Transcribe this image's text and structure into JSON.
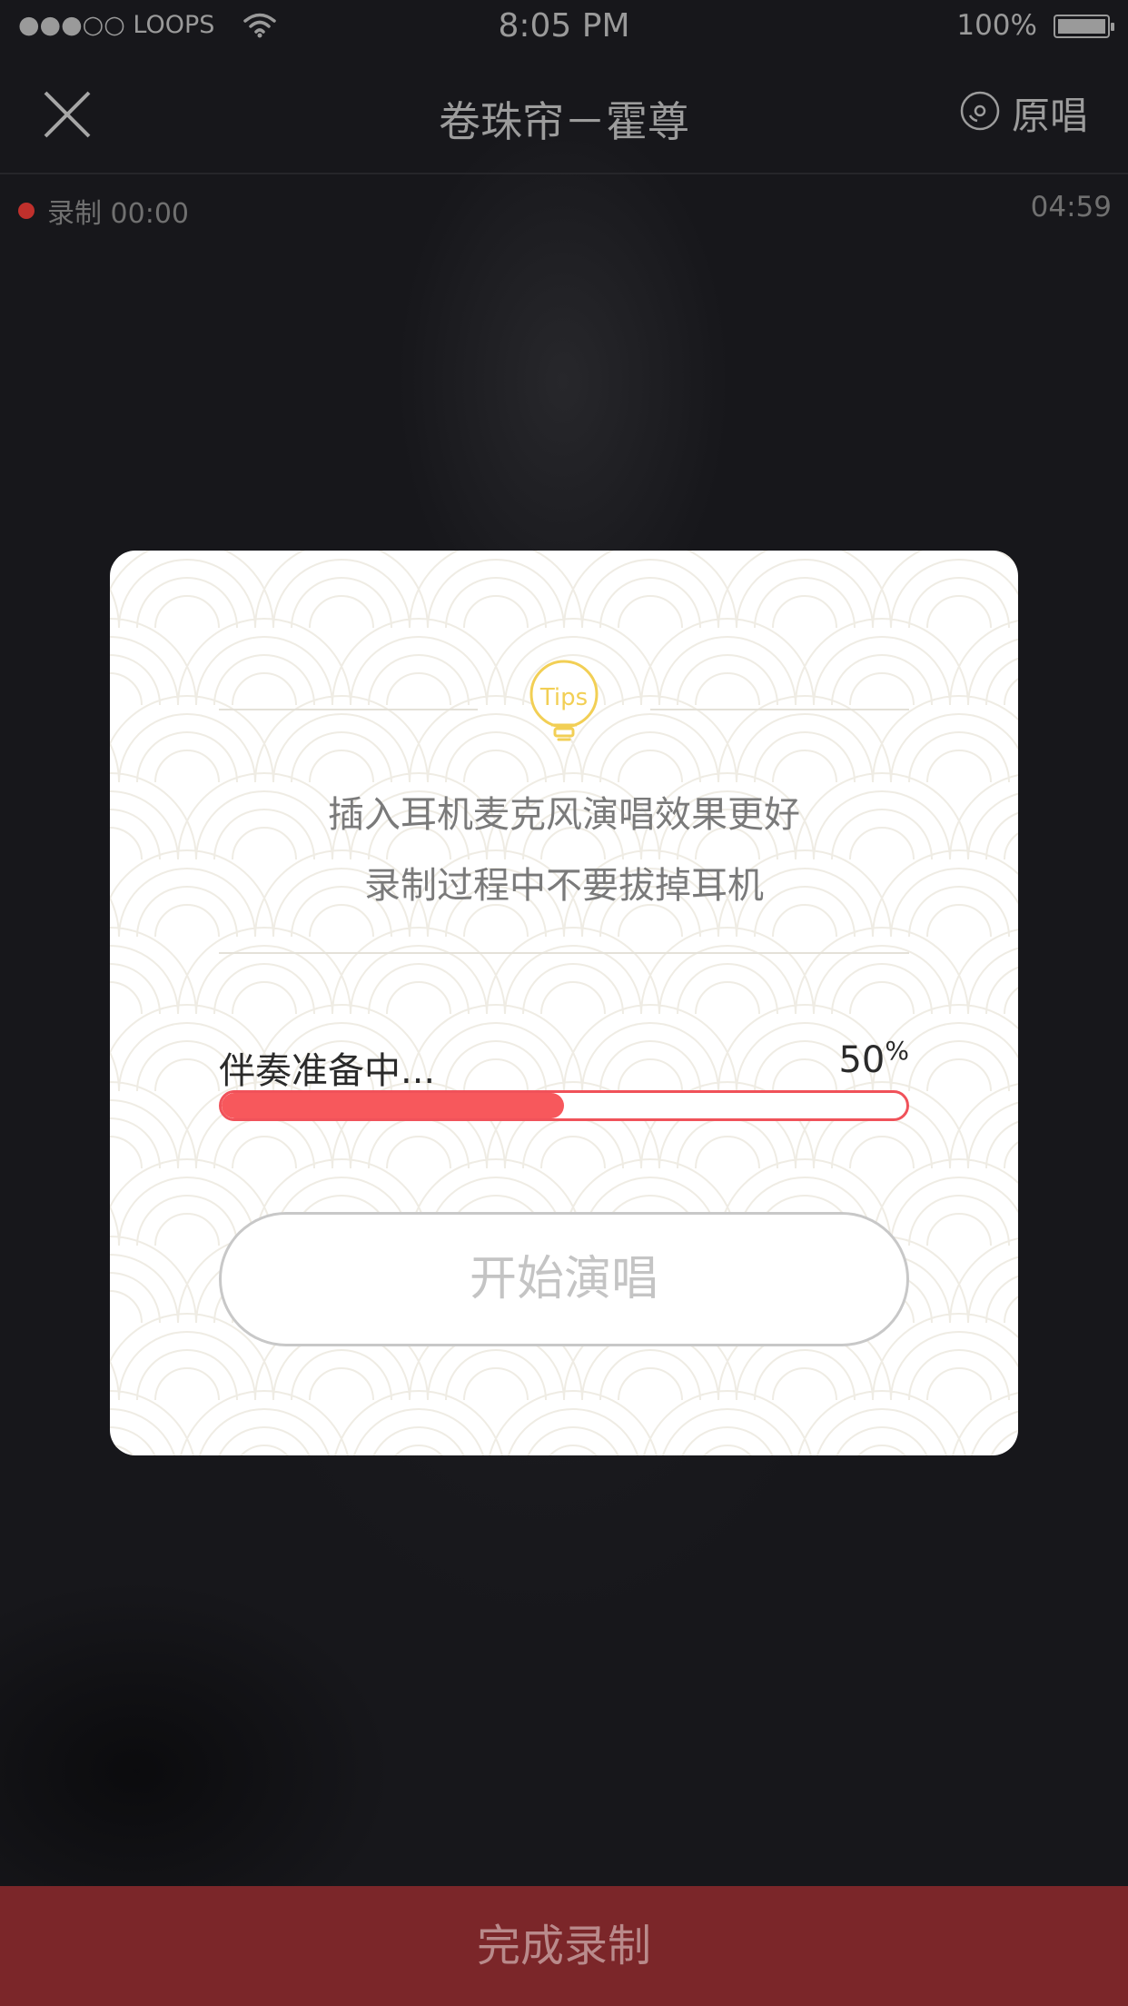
{
  "status_bar": {
    "carrier": "●●●○○ LOOPS",
    "time": "8:05 PM",
    "battery": "100%",
    "battery_level": 1.0,
    "wifi_icon": "wifi-icon"
  },
  "nav": {
    "close_icon": "close-icon",
    "title": "卷珠帘－霍尊",
    "original_icon": "disc-icon",
    "original_label": "原唱"
  },
  "recording": {
    "label": "录制 00:00",
    "total_time": "04:59",
    "dot_color": "#c0302c"
  },
  "modal": {
    "tips_icon": "lightbulb-tips-icon",
    "tips_text": "Tips",
    "tips_color": "#f2cf55",
    "message_line1": "插入耳机麦克风演唱效果更好",
    "message_line2": "录制过程中不要拔掉耳机",
    "progress_label": "伴奏准备中...",
    "progress_value": "50",
    "progress_sign": "%",
    "progress_fraction": 0.5,
    "progress_color": "#f7585c",
    "start_button": "开始演唱"
  },
  "footer": {
    "finish_button": "完成录制",
    "bar_color": "#7b2629"
  }
}
